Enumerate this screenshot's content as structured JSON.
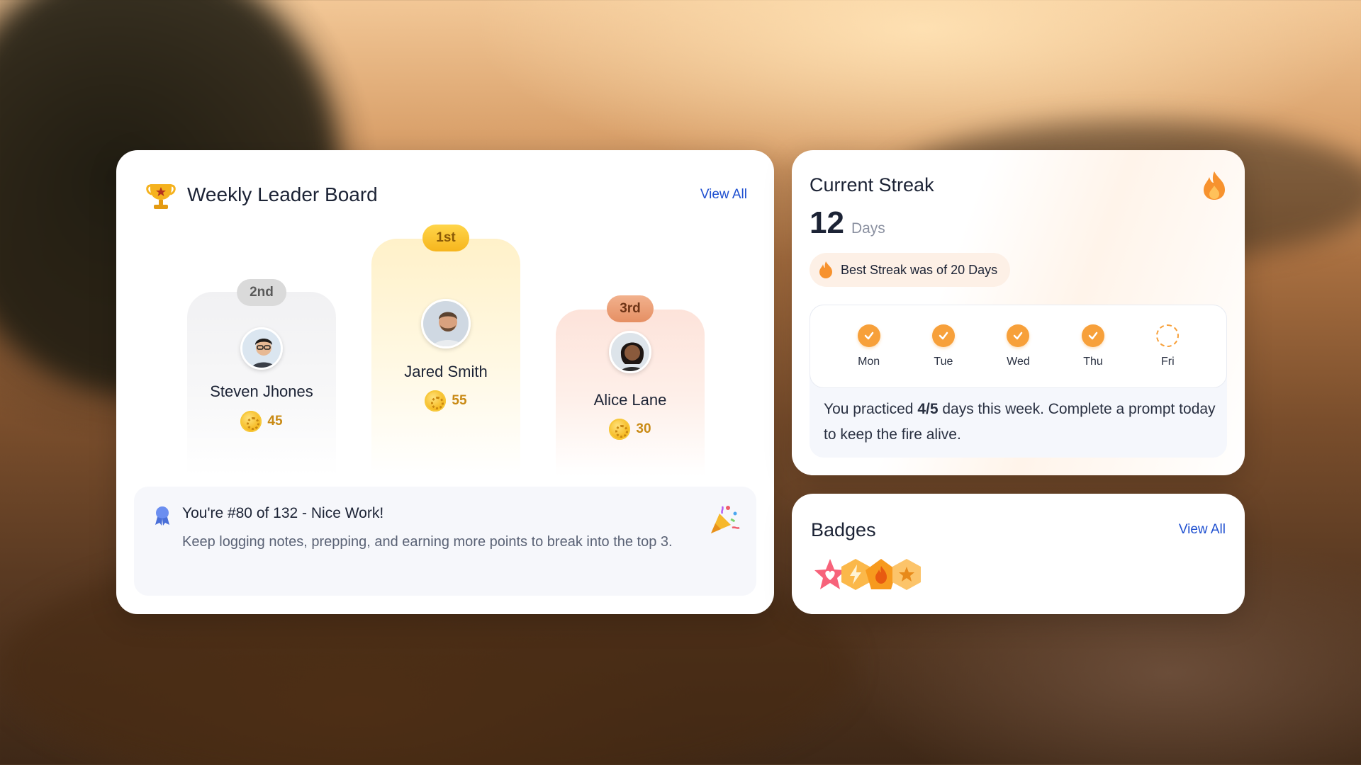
{
  "leaderboard": {
    "title": "Weekly Leader Board",
    "view_all": "View All",
    "podium": [
      {
        "rank": "2nd",
        "name": "Steven Jhones",
        "points": "45"
      },
      {
        "rank": "1st",
        "name": "Jared Smith",
        "points": "55"
      },
      {
        "rank": "3rd",
        "name": "Alice Lane",
        "points": "30"
      }
    ],
    "your_rank": {
      "title": "You're #80 of 132 - Nice Work!",
      "message": "Keep logging notes, prepping, and earning more points to break into the top 3."
    }
  },
  "streak": {
    "title": "Current Streak",
    "count": "12",
    "unit": "Days",
    "best": "Best Streak was of 20 Days",
    "days": [
      {
        "label": "Mon",
        "done": true
      },
      {
        "label": "Tue",
        "done": true
      },
      {
        "label": "Wed",
        "done": true
      },
      {
        "label": "Thu",
        "done": true
      },
      {
        "label": "Fri",
        "done": false
      }
    ],
    "message_pre": "You practiced ",
    "message_bold": "4/5",
    "message_post": " days this week. Complete a prompt today to keep the fire alive."
  },
  "badges": {
    "title": "Badges",
    "view_all": "View All",
    "items": [
      "heart-star-badge-icon",
      "lightning-hexagon-badge-icon",
      "fire-pentagon-badge-icon",
      "star-hexagon-badge-icon"
    ]
  },
  "colors": {
    "accent_blue": "#1e4fd0",
    "streak_orange": "#f7a03a",
    "gold": "#f4b416",
    "silver": "#d9d9d9",
    "bronze": "#e8a27a"
  }
}
